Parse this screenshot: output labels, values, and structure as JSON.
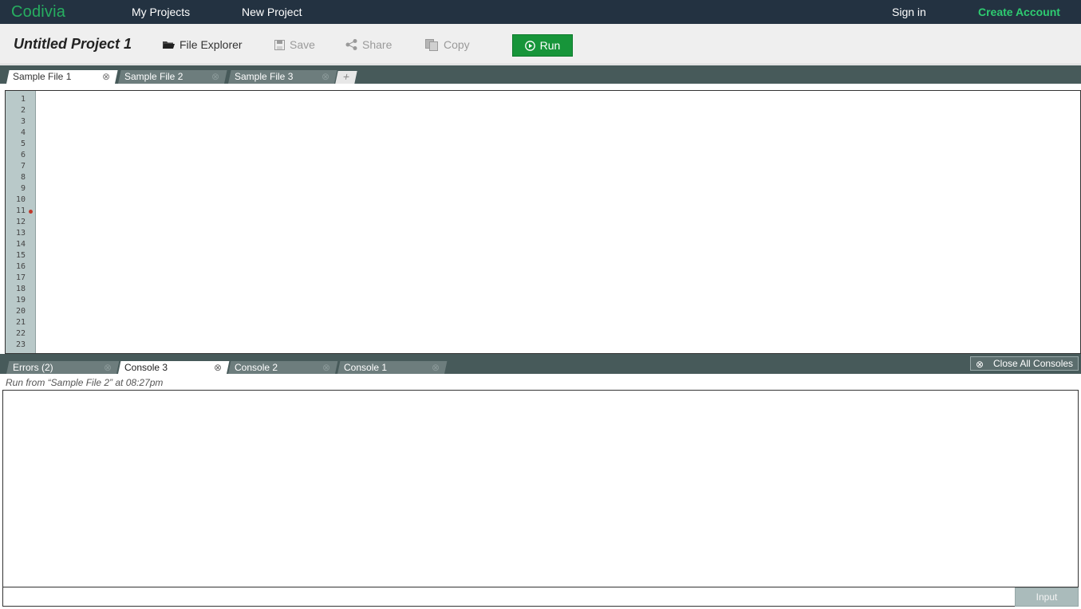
{
  "nav": {
    "brand": "Codivia",
    "my_projects": "My Projects",
    "new_project": "New Project",
    "sign_in": "Sign in",
    "create_account": "Create Account"
  },
  "toolbar": {
    "project_title": "Untitled Project 1",
    "file_explorer": "File Explorer",
    "save": "Save",
    "share": "Share",
    "copy": "Copy",
    "run": "Run"
  },
  "file_tabs": [
    {
      "label": "Sample File 1",
      "active": true
    },
    {
      "label": "Sample File 2",
      "active": false
    },
    {
      "label": "Sample File 3",
      "active": false
    }
  ],
  "add_tab_label": "+",
  "editor": {
    "line_numbers": [
      "1",
      "2",
      "3",
      "4",
      "5",
      "6",
      "7",
      "8",
      "9",
      "10",
      "11",
      "12",
      "13",
      "14",
      "15",
      "16",
      "17",
      "18",
      "19",
      "20",
      "21",
      "22",
      "23"
    ],
    "breakpoint_line": 11
  },
  "console_tabs": [
    {
      "label": "Errors (2)",
      "active": false
    },
    {
      "label": "Console 3",
      "active": true
    },
    {
      "label": "Console 2",
      "active": false
    },
    {
      "label": "Console 1",
      "active": false
    }
  ],
  "close_all_consoles": "Close All Consoles",
  "run_info": "Run from “Sample File 2” at 08:27pm",
  "input_button": "Input",
  "colors": {
    "nav_bg": "#233241",
    "brand": "#27ae60",
    "run_button": "#17953a",
    "tab_strip": "#475a5a",
    "gutter": "#b9c9c9",
    "breakpoint": "#c0392b"
  }
}
